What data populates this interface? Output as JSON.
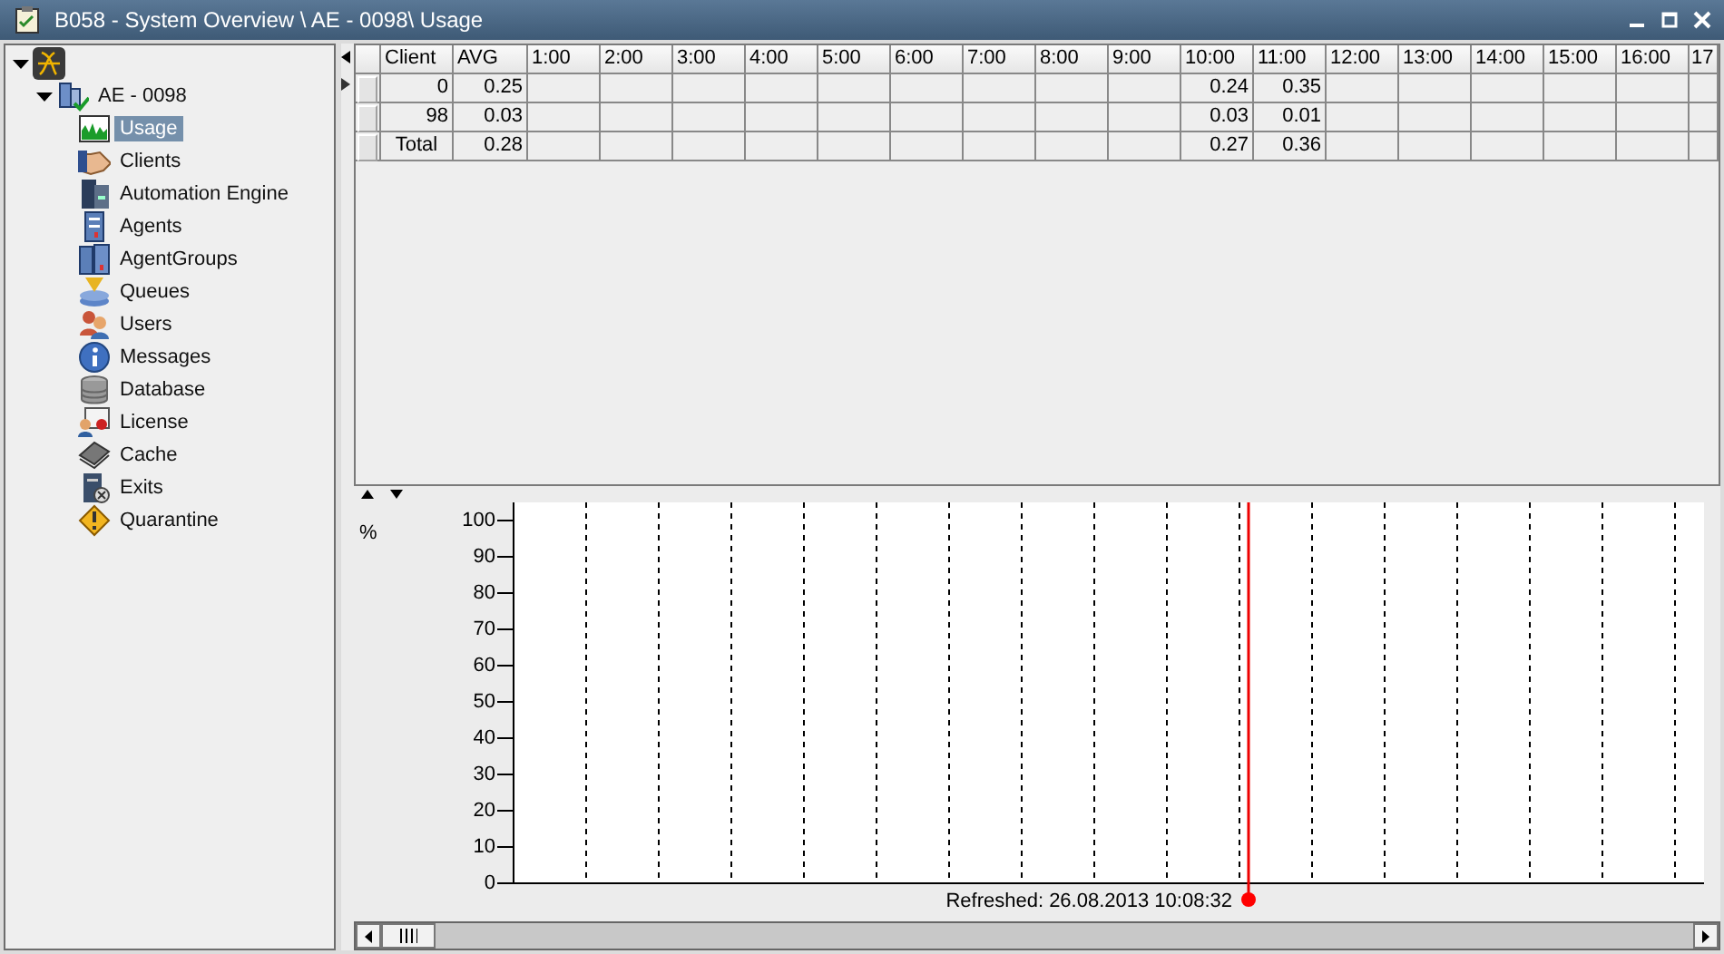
{
  "window": {
    "title": "B058 - System Overview \\ AE - 0098\\ Usage"
  },
  "tree": {
    "expanded": true,
    "children": [
      {
        "label": "AE - 0098",
        "expanded": true,
        "children": [
          {
            "label": "Usage",
            "selected": true
          },
          {
            "label": "Clients",
            "selected": false
          },
          {
            "label": "Automation Engine",
            "selected": false
          },
          {
            "label": "Agents",
            "selected": false
          },
          {
            "label": "AgentGroups",
            "selected": false
          },
          {
            "label": "Queues",
            "selected": false
          },
          {
            "label": "Users",
            "selected": false
          },
          {
            "label": "Messages",
            "selected": false
          },
          {
            "label": "Database",
            "selected": false
          },
          {
            "label": "License",
            "selected": false
          },
          {
            "label": "Cache",
            "selected": false
          },
          {
            "label": "Exits",
            "selected": false
          },
          {
            "label": "Quarantine",
            "selected": false
          }
        ]
      }
    ]
  },
  "table": {
    "rows": [
      {
        "kind": "data",
        "selected": true
      },
      {
        "kind": "data",
        "selected": false
      },
      {
        "kind": "total",
        "selected": false
      }
    ],
    "columns": [
      {
        "label": "Client",
        "values": [
          "0",
          "98",
          "Total"
        ]
      },
      {
        "label": "AVG",
        "values": [
          "0.25",
          "0.03",
          "0.28"
        ]
      },
      {
        "label": "1:00"
      },
      {
        "label": "2:00"
      },
      {
        "label": "3:00"
      },
      {
        "label": "4:00"
      },
      {
        "label": "5:00"
      },
      {
        "label": "6:00"
      },
      {
        "label": "7:00"
      },
      {
        "label": "8:00"
      },
      {
        "label": "9:00"
      },
      {
        "label": "10:00",
        "values": [
          "0.24",
          "0.03",
          "0.27"
        ]
      },
      {
        "label": "11:00",
        "values": [
          "0.35",
          "0.01",
          "0.36"
        ]
      },
      {
        "label": "12:00"
      },
      {
        "label": "13:00"
      },
      {
        "label": "14:00"
      },
      {
        "label": "15:00"
      },
      {
        "label": "16:00"
      },
      {
        "label": "17"
      }
    ]
  },
  "chart": {
    "chart_data": {
      "type": "line",
      "ylabel": "%",
      "categories": [
        null,
        null,
        null,
        null,
        null,
        null,
        null,
        null,
        null,
        null,
        null,
        null,
        null,
        null,
        null,
        null
      ],
      "values": [
        null,
        null,
        null,
        null,
        null,
        null,
        null,
        null,
        null,
        null,
        null,
        null,
        null,
        null,
        null,
        null
      ],
      "ylim": [
        0,
        105
      ],
      "yticks": [
        0,
        10,
        20,
        30,
        40,
        50,
        60,
        70,
        80,
        90,
        100
      ]
    },
    "status": "Refreshed: 26.08.2013 10:08:32"
  }
}
